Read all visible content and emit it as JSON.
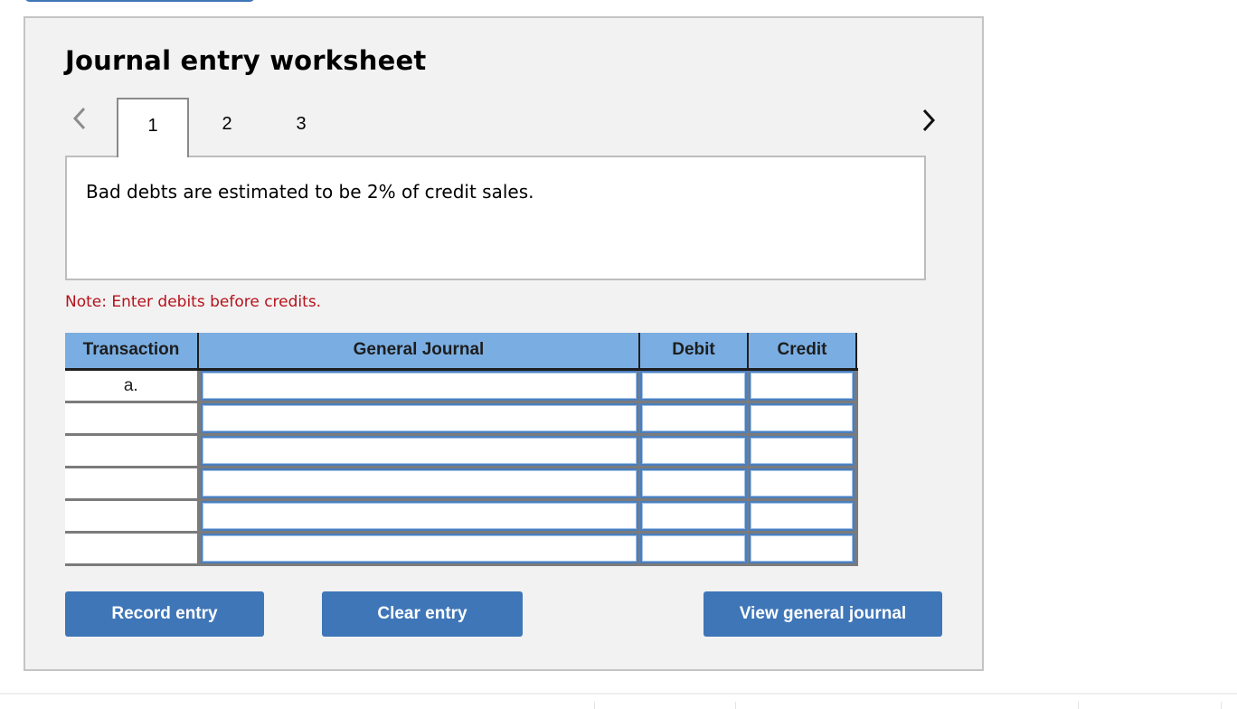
{
  "worksheet": {
    "title": "Journal entry worksheet",
    "tabs": [
      {
        "label": "1",
        "active": true
      },
      {
        "label": "2",
        "active": false
      },
      {
        "label": "3",
        "active": false
      }
    ],
    "nav": {
      "prev_icon": "chevron-left-icon",
      "next_icon": "chevron-right-icon"
    },
    "prompt": "Bad debts are estimated to be 2% of credit sales.",
    "note": "Note: Enter debits before credits."
  },
  "journal": {
    "headers": {
      "transaction": "Transaction",
      "general_journal": "General Journal",
      "debit": "Debit",
      "credit": "Credit"
    },
    "rows": [
      {
        "transaction": "a.",
        "account": "",
        "debit": "",
        "credit": ""
      },
      {
        "transaction": "",
        "account": "",
        "debit": "",
        "credit": ""
      },
      {
        "transaction": "",
        "account": "",
        "debit": "",
        "credit": ""
      },
      {
        "transaction": "",
        "account": "",
        "debit": "",
        "credit": ""
      },
      {
        "transaction": "",
        "account": "",
        "debit": "",
        "credit": ""
      },
      {
        "transaction": "",
        "account": "",
        "debit": "",
        "credit": ""
      }
    ]
  },
  "buttons": {
    "record": "Record entry",
    "clear": "Clear entry",
    "view": "View general journal"
  },
  "colors": {
    "accent": "#3e76b8",
    "header_bg": "#7aaee2",
    "note": "#b5121b",
    "panel_bg": "#f2f2f2"
  }
}
